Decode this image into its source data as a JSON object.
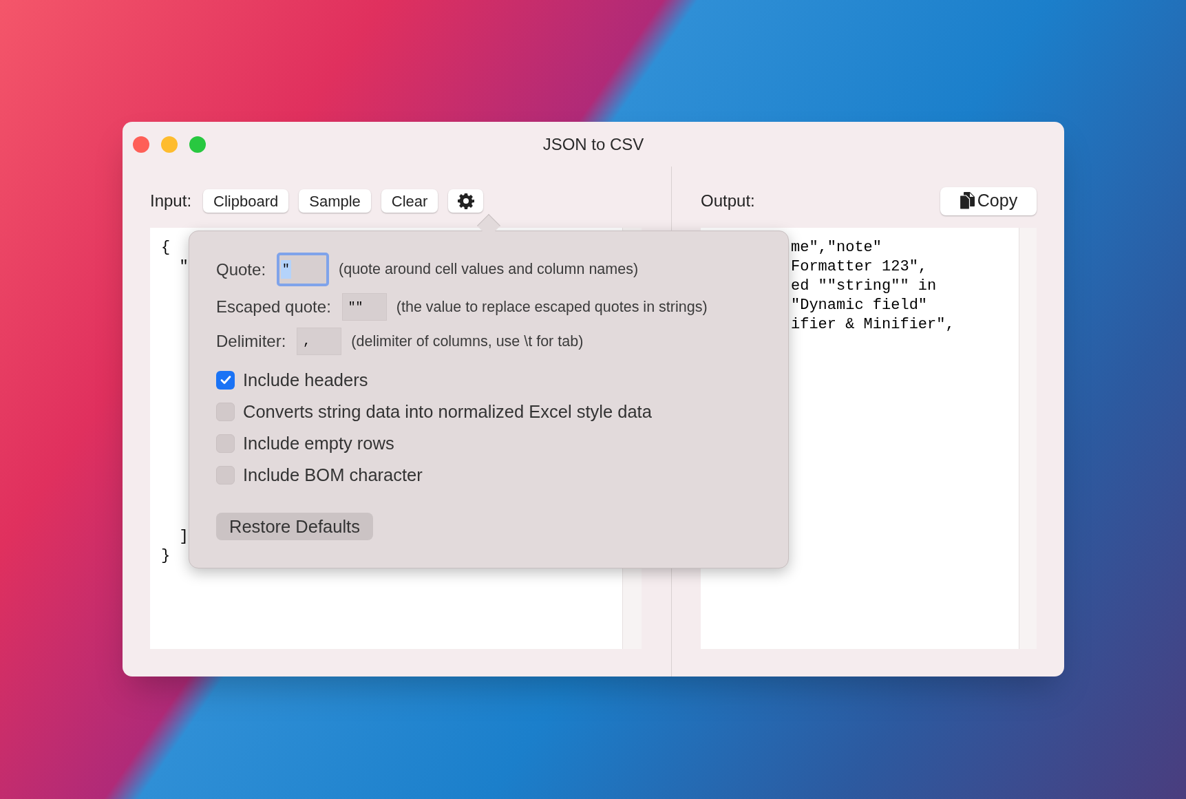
{
  "window": {
    "title": "JSON to CSV"
  },
  "input": {
    "label": "Input:",
    "buttons": [
      {
        "label": "Clipboard"
      },
      {
        "label": "Sample"
      },
      {
        "label": "Clear"
      }
    ],
    "lines_top": [
      "{",
      "  \""
    ],
    "lines_bottom": [
      "  ]",
      "}"
    ]
  },
  "output": {
    "label": "Output:",
    "copy_button": "Copy",
    "lines": [
      "me\",\"note\"",
      "Formatter 123\",",
      "ed \"\"string\"\" in",
      "\"Dynamic field\"",
      "ifier & Minifier\","
    ]
  },
  "settings": {
    "fields": [
      {
        "label": "Quote:",
        "value": "\"",
        "focused": true,
        "description": "(quote around cell values and column names)"
      },
      {
        "label": "Escaped quote:",
        "value": "\"\"",
        "focused": false,
        "description": "(the value to replace escaped quotes in strings)"
      },
      {
        "label": "Delimiter:",
        "value": ",",
        "focused": false,
        "description": "(delimiter of columns, use \\t for tab)"
      }
    ],
    "options": [
      {
        "label": "Include headers",
        "checked": true
      },
      {
        "label": "Converts string data into normalized Excel style data",
        "checked": false
      },
      {
        "label": "Include empty rows",
        "checked": false
      },
      {
        "label": "Include BOM character",
        "checked": false
      }
    ],
    "restore_button": "Restore Defaults"
  }
}
